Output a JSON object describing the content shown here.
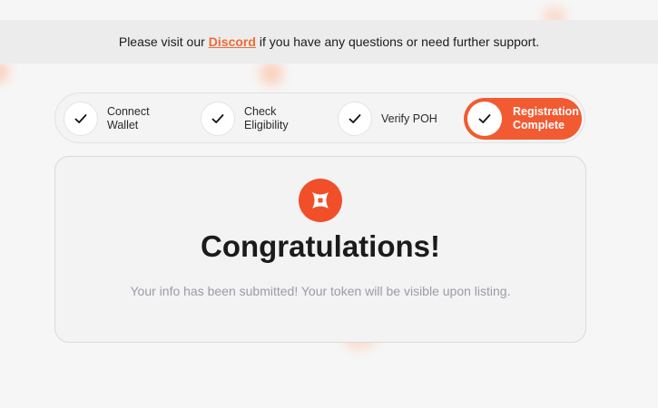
{
  "banner": {
    "prefix": "Please visit our",
    "link_text": "Discord",
    "suffix": "if you have any questions or need further support."
  },
  "steps": [
    {
      "label": "Connect\nWallet",
      "status": "done",
      "icon": "check-icon"
    },
    {
      "label": "Check\nEligibility",
      "status": "done",
      "icon": "check-icon"
    },
    {
      "label": "Verify POH",
      "status": "done",
      "icon": "check-icon"
    },
    {
      "label": "Registration\nComplete",
      "status": "active",
      "icon": "check-icon"
    }
  ],
  "card": {
    "icon": "brand-logo-icon",
    "title": "Congratulations!",
    "subtitle": "Your info has been submitted! Your token will be visible upon listing."
  },
  "colors": {
    "accent": "#f25a32",
    "link": "#f26a36",
    "muted_text": "#9a9ca6"
  }
}
